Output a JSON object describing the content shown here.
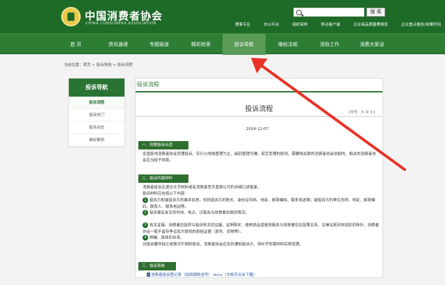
{
  "header": {
    "brand_cn": "中国消费者协会",
    "brand_en": "CHINA CONSUMERS ASSOCIATION",
    "search_label": "搜 索",
    "top_links": [
      "理事专区",
      "办公平台",
      "组织架构",
      "移动客户端",
      "企业商品质量黑榜库",
      "企业重点报告/收案时间"
    ]
  },
  "nav": {
    "items": [
      "首 页",
      "资讯速递",
      "专题报道",
      "精彩抢答",
      "投诉导航",
      "维权法规",
      "消协工作",
      "消费大家谈"
    ]
  },
  "breadcrumb": "当前位置：首页 > 投诉导航 > 投诉流程",
  "sidebar": {
    "title": "投诉导航",
    "items": [
      "投诉流程",
      "投诉热门",
      "投诉动态",
      "维权案例"
    ]
  },
  "content": {
    "section": "投诉流程",
    "title": "投诉流程",
    "font_switch": "[字号：大 中 小]",
    "date": "2014-12-07",
    "sections": [
      {
        "label": "一、到哪投诉合适",
        "text": "全国各地消费者协会受理投诉，实行以地域管理为主，级别管理为辅，就近受理的原则，需要相关联的消费者协会协助的，相关的消费者协会应当给予协助。"
      },
      {
        "label": "二、投诉所需材料",
        "text": "消费者投诉应递交文字材料或有消费者签字盖章认可的详细口述笔录。",
        "text2": "投诉材料应包括以下内容：",
        "items": [
          "投诉方和被投诉方的基本信息，包括投诉方的姓名、身份证号码、地址、邮政编码、联系电话等；被投诉方的单位名称、地址、邮政编码、联系人、联系电话等。",
          "投诉事实发生的时间、地点、过程及与经营者协商的情况。",
          "有关证据。消费者应提供与投诉有关的证据，证明购买、使用商品或接受服务与受损害存在因果关系。法律法规另有规定的除外。消费者协会一般不留存争议双方提供的原始证据（原件、实物等）。",
          "明确、具体的诉求。"
        ],
        "footer": "对投诉要件缺乏或情况不明的投诉，消费者协会应及时通知投诉方，待补齐所需材料后再受理。"
      },
      {
        "label": "三、投诉表格",
        "doc_link": "消费者投诉登记表（加网络陈述号）.docx（文档可点击下载）"
      }
    ]
  }
}
